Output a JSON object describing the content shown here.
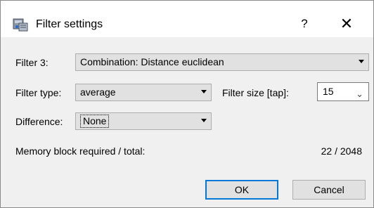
{
  "window": {
    "title": "Filter settings",
    "help_label": "?",
    "close_label": "✕",
    "app_icon": "filter-app-icon"
  },
  "filter": {
    "label": "Filter 3:",
    "value": "Combination: Distance euclidean"
  },
  "filter_type": {
    "label": "Filter type:",
    "value": "average"
  },
  "filter_size": {
    "label": "Filter size [tap]:",
    "value": "15"
  },
  "difference": {
    "label": "Difference:",
    "value": "None"
  },
  "memory": {
    "label": "Memory block required / total:",
    "value": "22 / 2048"
  },
  "buttons": {
    "ok": "OK",
    "cancel": "Cancel"
  },
  "colors": {
    "accent": "#0078d7",
    "dialog_bg": "#f0f0f0",
    "control_bg": "#e1e1e1"
  }
}
